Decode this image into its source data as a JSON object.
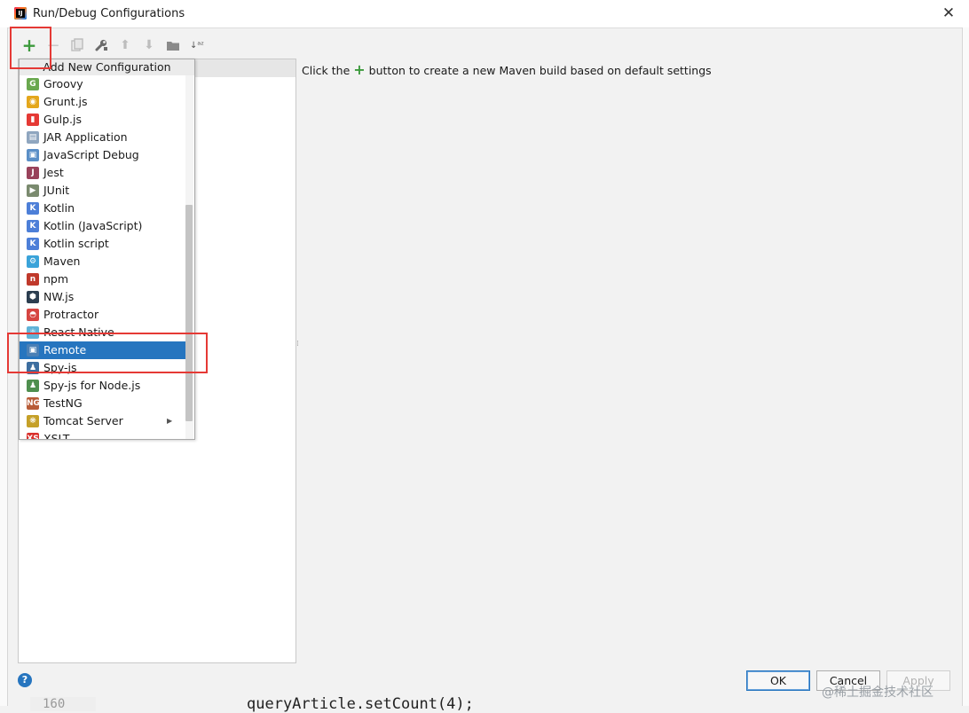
{
  "window": {
    "title": "Run/Debug Configurations",
    "close_glyph": "✕"
  },
  "toolbar": {
    "add": "+",
    "remove": "−",
    "move_up": "⬆",
    "move_down": "⬇",
    "sort": "↓ᵃᶻ"
  },
  "popup": {
    "title": "Add New Configuration",
    "items": [
      {
        "label": "Groovy",
        "icon": "groovy-icon",
        "color": "#6aa84f",
        "glyph": "G"
      },
      {
        "label": "Grunt.js",
        "icon": "grunt-icon",
        "color": "#e4a71c",
        "glyph": "◉"
      },
      {
        "label": "Gulp.js",
        "icon": "gulp-icon",
        "color": "#e53935",
        "glyph": "▮"
      },
      {
        "label": "JAR Application",
        "icon": "jar-icon",
        "color": "#8fa6bf",
        "glyph": "▤"
      },
      {
        "label": "JavaScript Debug",
        "icon": "js-debug-icon",
        "color": "#5b8fc7",
        "glyph": "▣"
      },
      {
        "label": "Jest",
        "icon": "jest-icon",
        "color": "#99425b",
        "glyph": "J"
      },
      {
        "label": "JUnit",
        "icon": "junit-icon",
        "color": "#7a8a6e",
        "glyph": "▶"
      },
      {
        "label": "Kotlin",
        "icon": "kotlin-icon",
        "color": "#4d7fd8",
        "glyph": "K"
      },
      {
        "label": "Kotlin (JavaScript)",
        "icon": "kotlin-js-icon",
        "color": "#4d7fd8",
        "glyph": "K"
      },
      {
        "label": "Kotlin script",
        "icon": "kotlin-script-icon",
        "color": "#4d7fd8",
        "glyph": "K"
      },
      {
        "label": "Maven",
        "icon": "maven-icon",
        "color": "#3aa3d9",
        "glyph": "⚙"
      },
      {
        "label": "npm",
        "icon": "npm-icon",
        "color": "#c0392b",
        "glyph": "n"
      },
      {
        "label": "NW.js",
        "icon": "nwjs-icon",
        "color": "#2c3e50",
        "glyph": "⬢"
      },
      {
        "label": "Protractor",
        "icon": "protractor-icon",
        "color": "#d64541",
        "glyph": "◓"
      },
      {
        "label": "React Native",
        "icon": "react-native-icon",
        "color": "#61b3d8",
        "glyph": "⚛"
      },
      {
        "label": "Remote",
        "icon": "remote-icon",
        "color": "#4a7fb5",
        "glyph": "▣"
      },
      {
        "label": "Spy-js",
        "icon": "spy-js-icon",
        "color": "#3d6e9f",
        "glyph": "♟"
      },
      {
        "label": "Spy-js for Node.js",
        "icon": "spy-js-node-icon",
        "color": "#4f8f4f",
        "glyph": "♟"
      },
      {
        "label": "TestNG",
        "icon": "testng-icon",
        "color": "#b85c38",
        "glyph": "NG"
      },
      {
        "label": "Tomcat Server",
        "icon": "tomcat-icon",
        "color": "#c5a028",
        "glyph": "❋",
        "submenu_arrow": "▶"
      },
      {
        "label": "XSLT",
        "icon": "xslt-icon",
        "color": "#d9302c",
        "glyph": "XS"
      }
    ],
    "selected_index": 15
  },
  "hint": {
    "before": "Click the",
    "plus": "+",
    "after": "button to create a new Maven build based on default settings"
  },
  "footer": {
    "help": "?",
    "ok": "OK",
    "cancel": "Cancel",
    "apply": "Apply"
  },
  "background": {
    "code": "queryArticle.setCount(4);",
    "line_number": "160",
    "watermark": "@稀土掘金技术社区"
  },
  "colors": {
    "highlight_red": "#e53935",
    "selection_blue": "#2675bf",
    "add_green": "#3c9a3c"
  }
}
